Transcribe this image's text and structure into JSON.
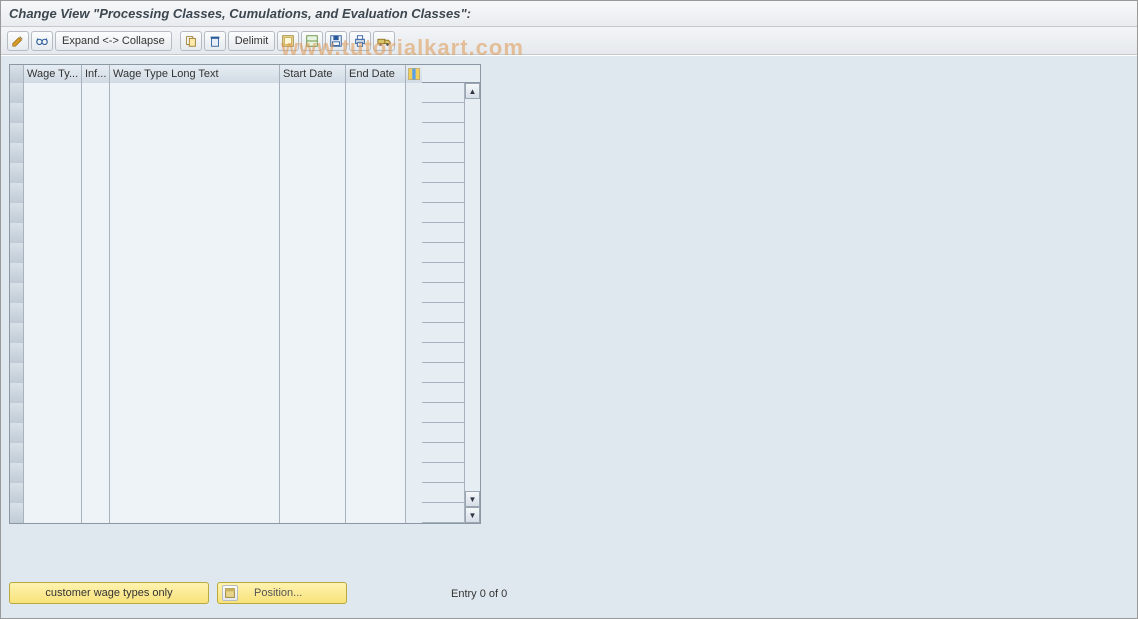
{
  "title": "Change View \"Processing Classes, Cumulations, and Evaluation Classes\":",
  "toolbar": {
    "expand_collapse_label": "Expand <-> Collapse",
    "delimit_label": "Delimit"
  },
  "grid": {
    "columns": {
      "wage_type": "Wage Ty...",
      "inf": "Inf...",
      "long_text": "Wage Type Long Text",
      "start_date": "Start Date",
      "end_date": "End Date"
    },
    "row_count": 22
  },
  "buttons": {
    "customer_only": "customer wage types only",
    "position": "Position..."
  },
  "status": {
    "entry": "Entry 0 of 0"
  },
  "watermark": "www.tutorialkart.com"
}
